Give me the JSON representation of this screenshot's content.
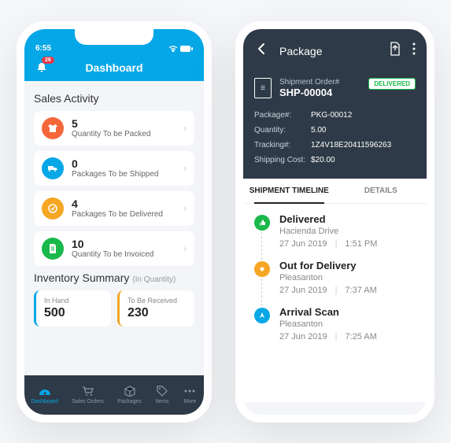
{
  "phone1": {
    "status": {
      "time": "6:55",
      "wifi": true,
      "battery": true
    },
    "bell_badge": "26",
    "title": "Dashboard",
    "sales_activity": {
      "title": "Sales Activity",
      "cards": [
        {
          "num": "5",
          "label": "Quantity To be Packed",
          "color": "#f5663b",
          "icon": "shirt"
        },
        {
          "num": "0",
          "label": "Packages To be Shipped",
          "color": "#06a7e6",
          "icon": "truck"
        },
        {
          "num": "4",
          "label": "Packages To be Delivered",
          "color": "#f5a623",
          "icon": "check"
        },
        {
          "num": "10",
          "label": "Quantity To be Invoiced",
          "color": "#19b84a",
          "icon": "doc"
        }
      ]
    },
    "inventory": {
      "title": "Inventory Summary",
      "subtitle": "(In Quantity)",
      "in_hand": {
        "label": "In Hand",
        "value": "500"
      },
      "to_be_received": {
        "label": "To Be Received",
        "value": "230"
      }
    },
    "tabs": [
      {
        "label": "Dashboard",
        "icon": "gauge",
        "active": true
      },
      {
        "label": "Sales Orders",
        "icon": "cart"
      },
      {
        "label": "Packages",
        "icon": "box"
      },
      {
        "label": "Items",
        "icon": "tag"
      },
      {
        "label": "More",
        "icon": "more"
      }
    ]
  },
  "phone2": {
    "title": "Package",
    "order_label": "Shipment Order#",
    "order_num": "SHP-00004",
    "status": "DELIVERED",
    "fields": {
      "package_k": "Package#:",
      "package_v": "PKG-00012",
      "qty_k": "Quantity:",
      "qty_v": "5.00",
      "track_k": "Tracking#:",
      "track_v": "1Z4V18E20411596263",
      "cost_k": "Shipping Cost:",
      "cost_v": "$20.00"
    },
    "tabs": {
      "timeline": "SHIPMENT TIMELINE",
      "details": "DETAILS"
    },
    "timeline": [
      {
        "title": "Delivered",
        "sub": "Hacienda Drive",
        "date": "27 Jun 2019",
        "time": "1:51 PM",
        "color": "#19b84a",
        "icon": "thumb"
      },
      {
        "title": "Out for Delivery",
        "sub": "Pleasanton",
        "date": "27 Jun 2019",
        "time": "7:37 AM",
        "color": "#f5a623",
        "icon": "dot"
      },
      {
        "title": "Arrival Scan",
        "sub": "Pleasanton",
        "date": "27 Jun 2019",
        "time": "7:25 AM",
        "color": "#06a7e6",
        "icon": "nav"
      }
    ]
  }
}
